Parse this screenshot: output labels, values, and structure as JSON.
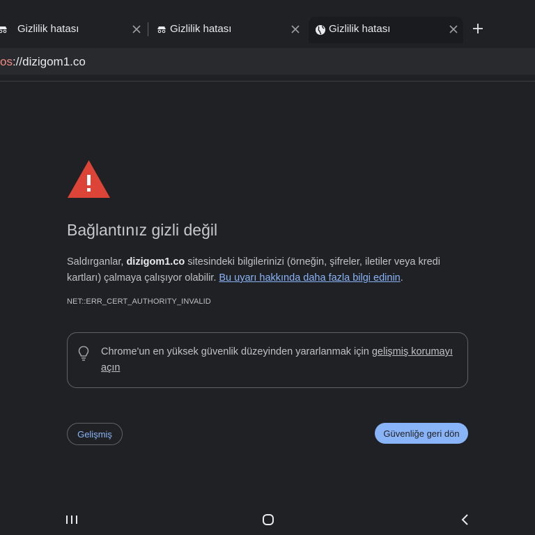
{
  "tabs": [
    {
      "title": "Gizlilik hatası",
      "favicon": "incognito-icon",
      "active": false
    },
    {
      "title": "Gizlilik hatası",
      "favicon": "incognito-icon",
      "active": false
    },
    {
      "title": "Gizlilik hatası",
      "favicon": "globe-icon",
      "active": true
    }
  ],
  "omnibox": {
    "scheme": "os",
    "url_rest": "://dizigom1.co"
  },
  "error_page": {
    "title": "Bağlantınız gizli değil",
    "desc_1": "Saldırganlar, ",
    "desc_domain": "dizigom1.co",
    "desc_2": " sitesindeki bilgilerinizi (örneğin, şifreler, iletiler veya kredi kartları) çalmaya çalışıyor olabilir. ",
    "desc_link": "Bu uyarı hakkında daha fazla bilgi edinin",
    "desc_end": ".",
    "error_code": "NET::ERR_CERT_AUTHORITY_INVALID",
    "notice_text": "Chrome'un en yüksek güvenlik düzeyinden yararlanmak için ",
    "notice_link": "gelişmiş korumayı açın",
    "advanced_label": "Gelişmiş",
    "back_label": "Güvenliğe geri dön"
  },
  "colors": {
    "warning": "#db4437",
    "accent": "#8ab4f8",
    "scheme": "#f28b82"
  }
}
